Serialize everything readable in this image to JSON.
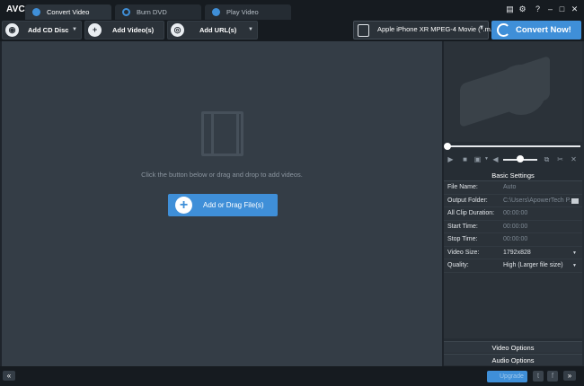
{
  "app": {
    "logo": "AVC"
  },
  "tabs": [
    {
      "label": "Convert Video"
    },
    {
      "label": "Burn DVD"
    },
    {
      "label": "Play Video"
    }
  ],
  "toolbar": {
    "add_cd": "Add CD Disc",
    "add_videos": "Add Video(s)",
    "add_url": "Add URL(s)",
    "profile": "Apple iPhone XR MPEG-4 Movie (*.m...",
    "convert": "Convert Now!"
  },
  "main": {
    "hint": "Click the button below or drag and drop to add videos.",
    "add_button": "Add or Drag File(s)"
  },
  "settings": {
    "title": "Basic Settings",
    "rows": [
      {
        "key": "File Name:",
        "value": "Auto"
      },
      {
        "key": "Output Folder:",
        "value": "C:\\Users\\ApowerTech P..."
      },
      {
        "key": "All Clip Duration:",
        "value": "00:00:00"
      },
      {
        "key": "Start Time:",
        "value": "00:00:00"
      },
      {
        "key": "Stop Time:",
        "value": "00:00:00"
      },
      {
        "key": "Video Size:",
        "value": "1792x828"
      },
      {
        "key": "Quality:",
        "value": "High (Larger file size)"
      }
    ],
    "video_options": "Video Options",
    "audio_options": "Audio Options"
  },
  "player": {
    "seek_position": 0,
    "volume_level": 0.5
  },
  "bottom": {
    "upgrade": "Upgrade"
  },
  "colors": {
    "accent": "#3f8fd8",
    "background": "#343d46",
    "titlebar": "#161b20"
  }
}
